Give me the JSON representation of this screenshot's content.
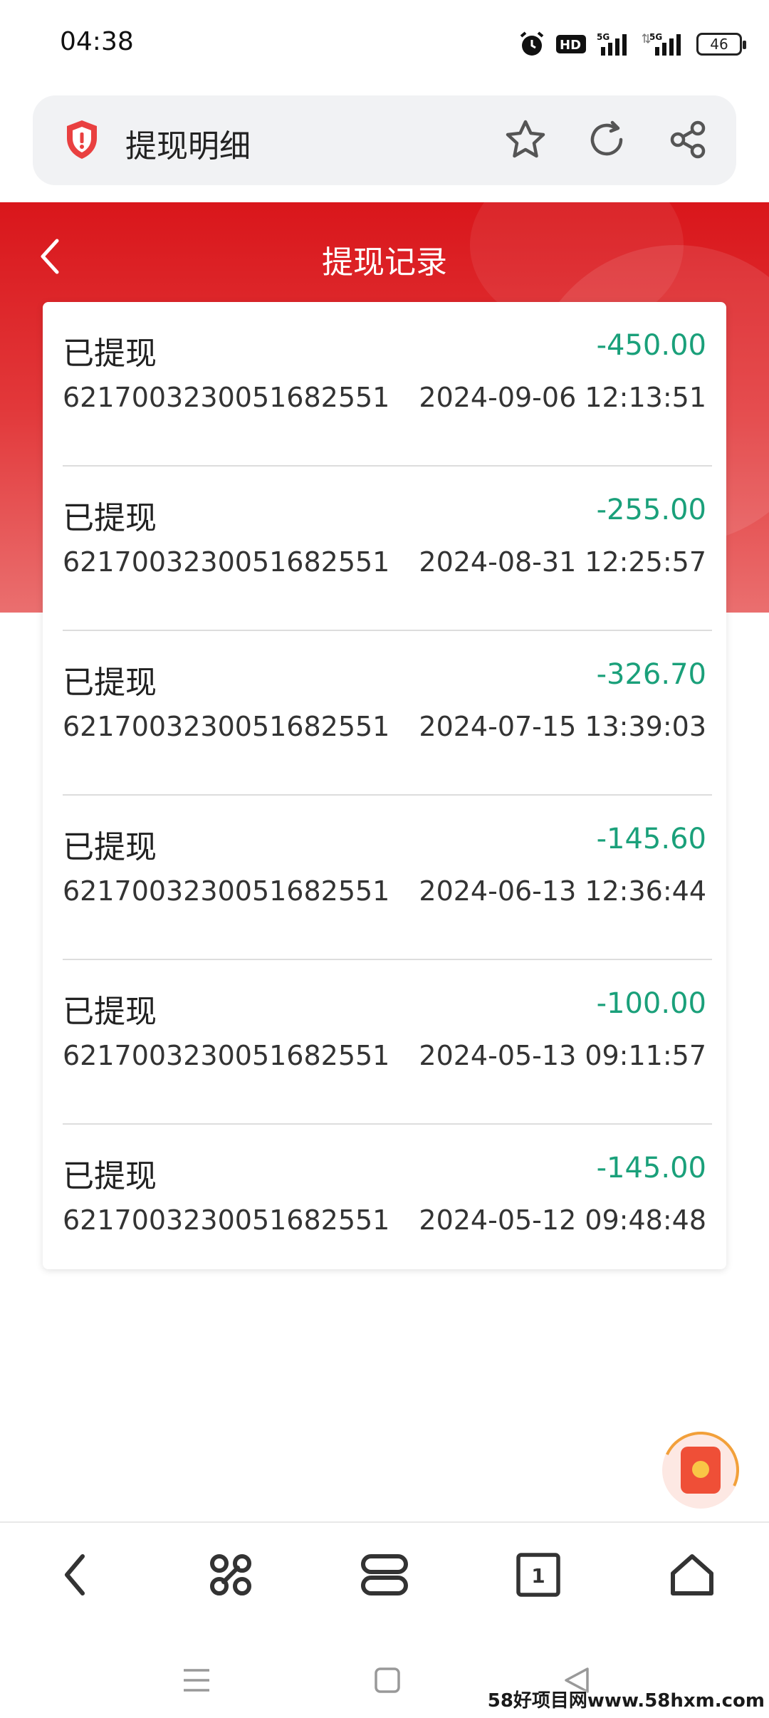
{
  "status_bar": {
    "time": "04:38",
    "battery": "46",
    "icons": [
      "alarm-icon",
      "hd-icon",
      "signal-5g-icon",
      "signal-5g-icon",
      "battery-icon"
    ]
  },
  "url_bar": {
    "title": "提现明细",
    "icons": [
      "shield-alert-icon",
      "star-icon",
      "refresh-icon",
      "share-icon"
    ]
  },
  "header": {
    "title": "提现记录",
    "accent_color": "#d9161b"
  },
  "records": [
    {
      "status": "已提现",
      "amount": "-450.00",
      "account": "6217003230051682551",
      "time": "2024-09-06 12:13:51"
    },
    {
      "status": "已提现",
      "amount": "-255.00",
      "account": "6217003230051682551",
      "time": "2024-08-31 12:25:57"
    },
    {
      "status": "已提现",
      "amount": "-326.70",
      "account": "6217003230051682551",
      "time": "2024-07-15 13:39:03"
    },
    {
      "status": "已提现",
      "amount": "-145.60",
      "account": "6217003230051682551",
      "time": "2024-06-13 12:36:44"
    },
    {
      "status": "已提现",
      "amount": "-100.00",
      "account": "6217003230051682551",
      "time": "2024-05-13 09:11:57"
    },
    {
      "status": "已提现",
      "amount": "-145.00",
      "account": "6217003230051682551",
      "time": "2024-05-12 09:48:48"
    }
  ],
  "amount_color": "#1aa07a",
  "bottom_nav": {
    "tab_count": "1",
    "icons": [
      "back-icon",
      "command-icon",
      "layers-icon",
      "tabs-icon",
      "home-icon"
    ]
  },
  "watermark": "58好项目网www.58hxm.com"
}
